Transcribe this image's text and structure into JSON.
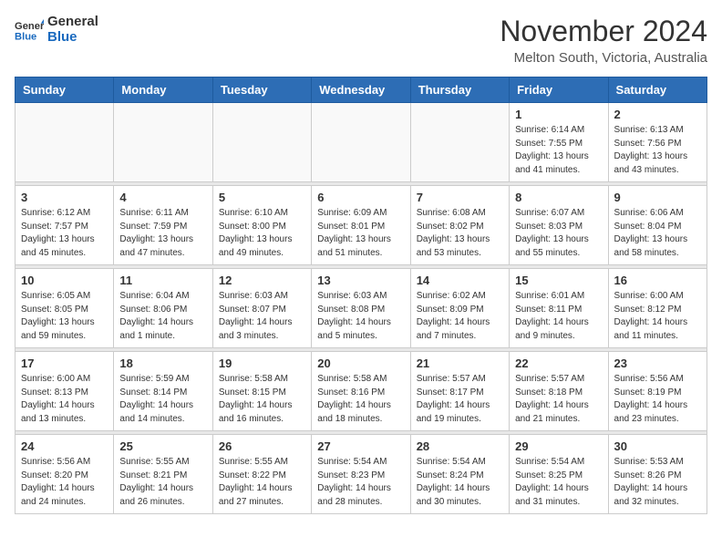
{
  "header": {
    "logo_text_general": "General",
    "logo_text_blue": "Blue",
    "main_title": "November 2024",
    "subtitle": "Melton South, Victoria, Australia"
  },
  "days_of_week": [
    "Sunday",
    "Monday",
    "Tuesday",
    "Wednesday",
    "Thursday",
    "Friday",
    "Saturday"
  ],
  "weeks": [
    [
      {
        "day": "",
        "empty": true
      },
      {
        "day": "",
        "empty": true
      },
      {
        "day": "",
        "empty": true
      },
      {
        "day": "",
        "empty": true
      },
      {
        "day": "",
        "empty": true
      },
      {
        "day": "1",
        "sunrise": "6:14 AM",
        "sunset": "7:55 PM",
        "daylight": "13 hours and 41 minutes."
      },
      {
        "day": "2",
        "sunrise": "6:13 AM",
        "sunset": "7:56 PM",
        "daylight": "13 hours and 43 minutes."
      }
    ],
    [
      {
        "day": "3",
        "sunrise": "6:12 AM",
        "sunset": "7:57 PM",
        "daylight": "13 hours and 45 minutes."
      },
      {
        "day": "4",
        "sunrise": "6:11 AM",
        "sunset": "7:59 PM",
        "daylight": "13 hours and 47 minutes."
      },
      {
        "day": "5",
        "sunrise": "6:10 AM",
        "sunset": "8:00 PM",
        "daylight": "13 hours and 49 minutes."
      },
      {
        "day": "6",
        "sunrise": "6:09 AM",
        "sunset": "8:01 PM",
        "daylight": "13 hours and 51 minutes."
      },
      {
        "day": "7",
        "sunrise": "6:08 AM",
        "sunset": "8:02 PM",
        "daylight": "13 hours and 53 minutes."
      },
      {
        "day": "8",
        "sunrise": "6:07 AM",
        "sunset": "8:03 PM",
        "daylight": "13 hours and 55 minutes."
      },
      {
        "day": "9",
        "sunrise": "6:06 AM",
        "sunset": "8:04 PM",
        "daylight": "13 hours and 58 minutes."
      }
    ],
    [
      {
        "day": "10",
        "sunrise": "6:05 AM",
        "sunset": "8:05 PM",
        "daylight": "13 hours and 59 minutes."
      },
      {
        "day": "11",
        "sunrise": "6:04 AM",
        "sunset": "8:06 PM",
        "daylight": "14 hours and 1 minute."
      },
      {
        "day": "12",
        "sunrise": "6:03 AM",
        "sunset": "8:07 PM",
        "daylight": "14 hours and 3 minutes."
      },
      {
        "day": "13",
        "sunrise": "6:03 AM",
        "sunset": "8:08 PM",
        "daylight": "14 hours and 5 minutes."
      },
      {
        "day": "14",
        "sunrise": "6:02 AM",
        "sunset": "8:09 PM",
        "daylight": "14 hours and 7 minutes."
      },
      {
        "day": "15",
        "sunrise": "6:01 AM",
        "sunset": "8:11 PM",
        "daylight": "14 hours and 9 minutes."
      },
      {
        "day": "16",
        "sunrise": "6:00 AM",
        "sunset": "8:12 PM",
        "daylight": "14 hours and 11 minutes."
      }
    ],
    [
      {
        "day": "17",
        "sunrise": "6:00 AM",
        "sunset": "8:13 PM",
        "daylight": "14 hours and 13 minutes."
      },
      {
        "day": "18",
        "sunrise": "5:59 AM",
        "sunset": "8:14 PM",
        "daylight": "14 hours and 14 minutes."
      },
      {
        "day": "19",
        "sunrise": "5:58 AM",
        "sunset": "8:15 PM",
        "daylight": "14 hours and 16 minutes."
      },
      {
        "day": "20",
        "sunrise": "5:58 AM",
        "sunset": "8:16 PM",
        "daylight": "14 hours and 18 minutes."
      },
      {
        "day": "21",
        "sunrise": "5:57 AM",
        "sunset": "8:17 PM",
        "daylight": "14 hours and 19 minutes."
      },
      {
        "day": "22",
        "sunrise": "5:57 AM",
        "sunset": "8:18 PM",
        "daylight": "14 hours and 21 minutes."
      },
      {
        "day": "23",
        "sunrise": "5:56 AM",
        "sunset": "8:19 PM",
        "daylight": "14 hours and 23 minutes."
      }
    ],
    [
      {
        "day": "24",
        "sunrise": "5:56 AM",
        "sunset": "8:20 PM",
        "daylight": "14 hours and 24 minutes."
      },
      {
        "day": "25",
        "sunrise": "5:55 AM",
        "sunset": "8:21 PM",
        "daylight": "14 hours and 26 minutes."
      },
      {
        "day": "26",
        "sunrise": "5:55 AM",
        "sunset": "8:22 PM",
        "daylight": "14 hours and 27 minutes."
      },
      {
        "day": "27",
        "sunrise": "5:54 AM",
        "sunset": "8:23 PM",
        "daylight": "14 hours and 28 minutes."
      },
      {
        "day": "28",
        "sunrise": "5:54 AM",
        "sunset": "8:24 PM",
        "daylight": "14 hours and 30 minutes."
      },
      {
        "day": "29",
        "sunrise": "5:54 AM",
        "sunset": "8:25 PM",
        "daylight": "14 hours and 31 minutes."
      },
      {
        "day": "30",
        "sunrise": "5:53 AM",
        "sunset": "8:26 PM",
        "daylight": "14 hours and 32 minutes."
      }
    ]
  ]
}
